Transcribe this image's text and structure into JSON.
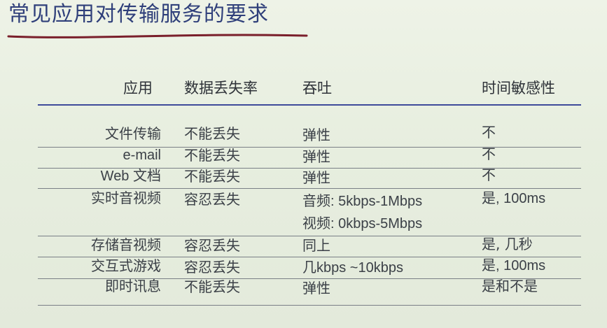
{
  "title": "常见应用对传输服务的要求",
  "headers": {
    "app": "应用",
    "loss": "数据丢失率",
    "throughput": "吞吐",
    "time": "时间敏感性"
  },
  "rows": [
    {
      "app": "文件传输",
      "loss": "不能丢失",
      "throughput": "弹性",
      "throughput2": "",
      "time": "不"
    },
    {
      "app": "e-mail",
      "loss": "不能丢失",
      "throughput": "弹性",
      "throughput2": "",
      "time": "不"
    },
    {
      "app": "Web 文档",
      "loss": "不能丢失",
      "throughput": "弹性",
      "throughput2": "",
      "time": "不"
    },
    {
      "app": "实时音视频",
      "loss": "容忍丢失",
      "throughput": "音频:   5kbps-1Mbps",
      "throughput2": "视频:  0kbps-5Mbps",
      "time": "是, 100ms"
    },
    {
      "app": "存储音视频",
      "loss": "容忍丢失",
      "throughput": "同上",
      "throughput2": "",
      "time": "是, 几秒"
    },
    {
      "app": "交互式游戏",
      "loss": "容忍丢失",
      "throughput": "几kbps ~10kbps",
      "throughput2": "",
      "time": "是, 100ms"
    },
    {
      "app": "即时讯息",
      "loss": "不能丢失",
      "throughput": "弹性",
      "throughput2": "",
      "time": "是和不是"
    }
  ],
  "colors": {
    "title": "#2f3f7a",
    "title_underline": "#7a1f2b",
    "header_rule": "#3e4a9a",
    "background": "#e7eedf"
  }
}
